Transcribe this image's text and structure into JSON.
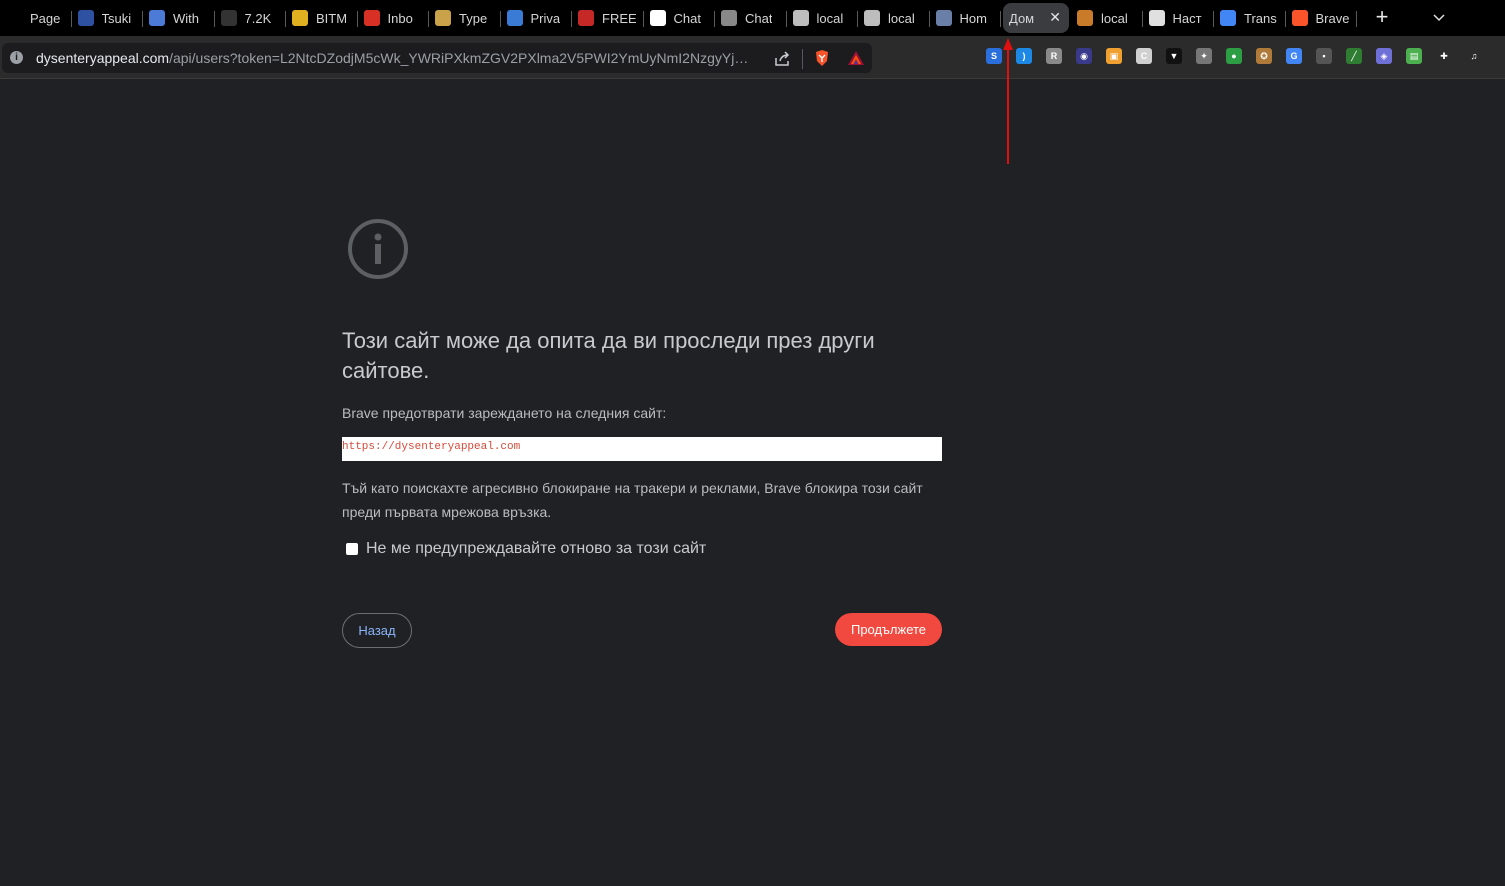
{
  "tabs": [
    {
      "title": "Page",
      "icon": "page-icon",
      "color": "#000000"
    },
    {
      "title": "Tsuki",
      "icon": "mal-icon",
      "color": "#2e51a2"
    },
    {
      "title": "With",
      "icon": "shield-icon",
      "color": "#4b7bd6"
    },
    {
      "title": "7.2K",
      "icon": "star-icon",
      "color": "#333333"
    },
    {
      "title": "BITM",
      "icon": "smiley-icon",
      "color": "#e0b020"
    },
    {
      "title": "Inbo",
      "icon": "gmail-icon",
      "color": "#d93025"
    },
    {
      "title": "Type",
      "icon": "typewriter-icon",
      "color": "#c9a24a"
    },
    {
      "title": "Priva",
      "icon": "dots-icon",
      "color": "#3a7bd5"
    },
    {
      "title": "FREE",
      "icon": "slash-icon",
      "color": "#c62828"
    },
    {
      "title": "Chat",
      "icon": "openai-icon",
      "color": "#ffffff"
    },
    {
      "title": "Chat",
      "icon": "atom-icon",
      "color": "#888888"
    },
    {
      "title": "local",
      "icon": "globe-icon",
      "color": "#bdbdbd"
    },
    {
      "title": "local",
      "icon": "globe-icon",
      "color": "#bdbdbd"
    },
    {
      "title": "Hom",
      "icon": "game-icon",
      "color": "#6a7fa8"
    },
    {
      "title": "Дом",
      "icon": "none",
      "color": "#3b3c3f",
      "active": true
    },
    {
      "title": "local",
      "icon": "ship-icon",
      "color": "#c97b2a"
    },
    {
      "title": "Наст",
      "icon": "gear-icon",
      "color": "#e0e0e0"
    },
    {
      "title": "Trans",
      "icon": "translate-icon",
      "color": "#4285f4"
    },
    {
      "title": "Brave",
      "icon": "brave-lion-icon",
      "color": "#fb542b"
    }
  ],
  "omnibox": {
    "host": "dysenteryappeal.com",
    "path": "/api/users?token=L2NtcDZodjM5cWk_YWRiPXkmZGV2PXlma2V5PWI2YmUyNmI2NzgyYjVhM..."
  },
  "extensions": [
    {
      "name": "ext-s-icon",
      "color": "#2a6fdb",
      "glyph": "S"
    },
    {
      "name": "ext-wave-icon",
      "color": "#1e88e5",
      "glyph": ")"
    },
    {
      "name": "ext-r-icon",
      "color": "#8a8a8a",
      "glyph": "R"
    },
    {
      "name": "ext-eye-icon",
      "color": "#3a3a8a",
      "glyph": "◉"
    },
    {
      "name": "ext-square-icon",
      "color": "#f0a030",
      "glyph": "▣"
    },
    {
      "name": "ext-c-icon",
      "color": "#d0d0d0",
      "glyph": "C"
    },
    {
      "name": "ext-ninja-icon",
      "color": "#111111",
      "glyph": "▼"
    },
    {
      "name": "ext-puzzle-icon",
      "color": "#777777",
      "glyph": "✦"
    },
    {
      "name": "ext-green-icon",
      "color": "#2e9e44",
      "glyph": "●"
    },
    {
      "name": "ext-cookie-icon",
      "color": "#b07a3a",
      "glyph": "✪"
    },
    {
      "name": "ext-translate-icon",
      "color": "#4285f4",
      "glyph": "G"
    },
    {
      "name": "ext-robot-icon",
      "color": "#555555",
      "glyph": "▪"
    },
    {
      "name": "ext-chart-icon",
      "color": "#2e7d32",
      "glyph": "╱"
    },
    {
      "name": "ext-lock-icon",
      "color": "#6f6fd8",
      "glyph": "◈"
    },
    {
      "name": "ext-image-icon",
      "color": "#4caf50",
      "glyph": "▤"
    },
    {
      "name": "extensions-icon",
      "color": "#2b2b2b",
      "glyph": "✚"
    },
    {
      "name": "media-icon",
      "color": "#2b2b2b",
      "glyph": "♫"
    }
  ],
  "page": {
    "headline": "Този сайт може да опита да ви проследи през други сайтове.",
    "subtitle": "Brave предотврати зареждането на следния сайт:",
    "blocked_url": "https://dysenteryappeal.com",
    "explanation": "Тъй като поискахте агресивно блокиране на тракери и реклами, Brave блокира този сайт преди първата мрежова връзка.",
    "checkbox_label": "Не ме предупреждавайте отново за този сайт",
    "back_label": "Назад",
    "continue_label": "Продължете"
  },
  "colors": {
    "background": "#202124",
    "continue_button": "#f1483f",
    "back_text": "#8ab4f8",
    "blocked_url_text": "#d44c3a",
    "annotation_arrow": "#e01010"
  }
}
